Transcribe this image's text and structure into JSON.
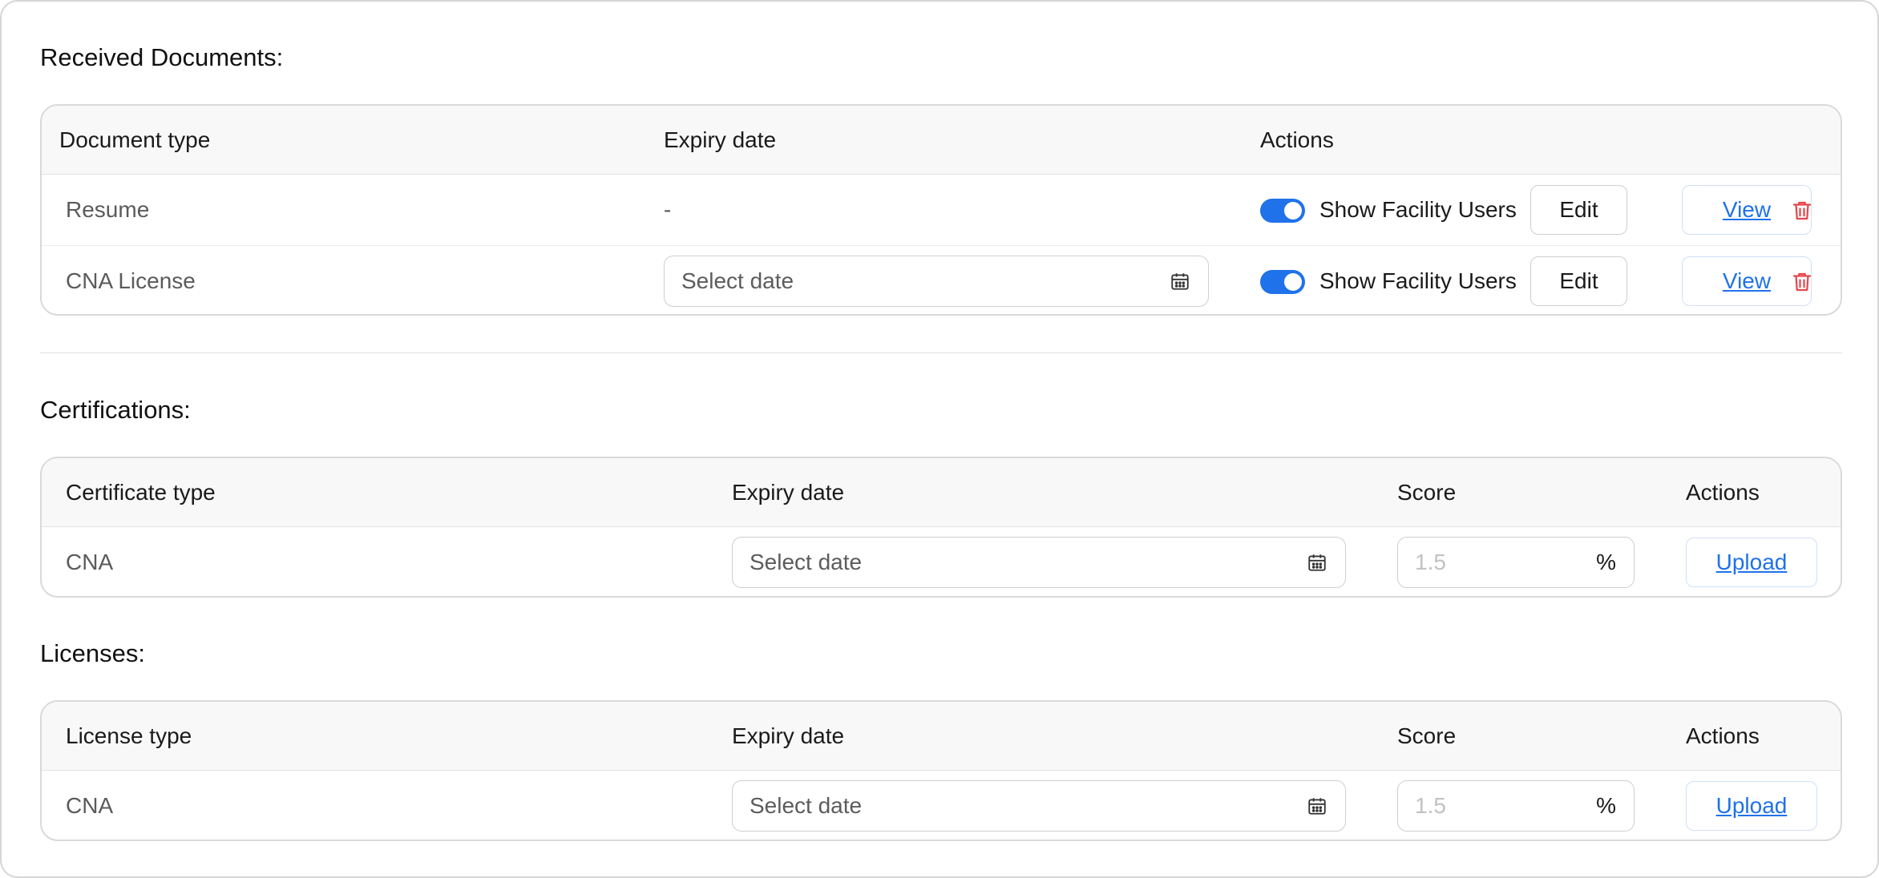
{
  "received": {
    "title": "Received Documents:",
    "headers": {
      "type": "Document type",
      "expiry": "Expiry date",
      "actions": "Actions"
    },
    "rows": [
      {
        "type": "Resume",
        "expiry": "-",
        "toggle_label": "Show Facility Users",
        "toggle_on": true,
        "edit": "Edit",
        "view": "View"
      },
      {
        "type": "CNA License",
        "expiry_placeholder": "Select date",
        "toggle_label": "Show Facility Users",
        "toggle_on": true,
        "edit": "Edit",
        "view": "View"
      }
    ]
  },
  "certifications": {
    "title": "Certifications:",
    "headers": {
      "type": "Certificate type",
      "expiry": "Expiry date",
      "score": "Score",
      "actions": "Actions"
    },
    "rows": [
      {
        "type": "CNA",
        "expiry_placeholder": "Select date",
        "score_placeholder": "1.5",
        "score_unit": "%",
        "upload": "Upload"
      }
    ]
  },
  "licenses": {
    "title": "Licenses:",
    "headers": {
      "type": "License type",
      "expiry": "Expiry date",
      "score": "Score",
      "actions": "Actions"
    },
    "rows": [
      {
        "type": "CNA",
        "expiry_placeholder": "Select date",
        "score_placeholder": "1.5",
        "score_unit": "%",
        "upload": "Upload"
      }
    ]
  },
  "colors": {
    "accent": "#1f72ea",
    "danger": "#e5484d",
    "border": "#d9d9d9",
    "header_bg": "#f8f8f8"
  },
  "icons": {
    "calendar": "calendar-icon",
    "delete": "trash-icon"
  }
}
